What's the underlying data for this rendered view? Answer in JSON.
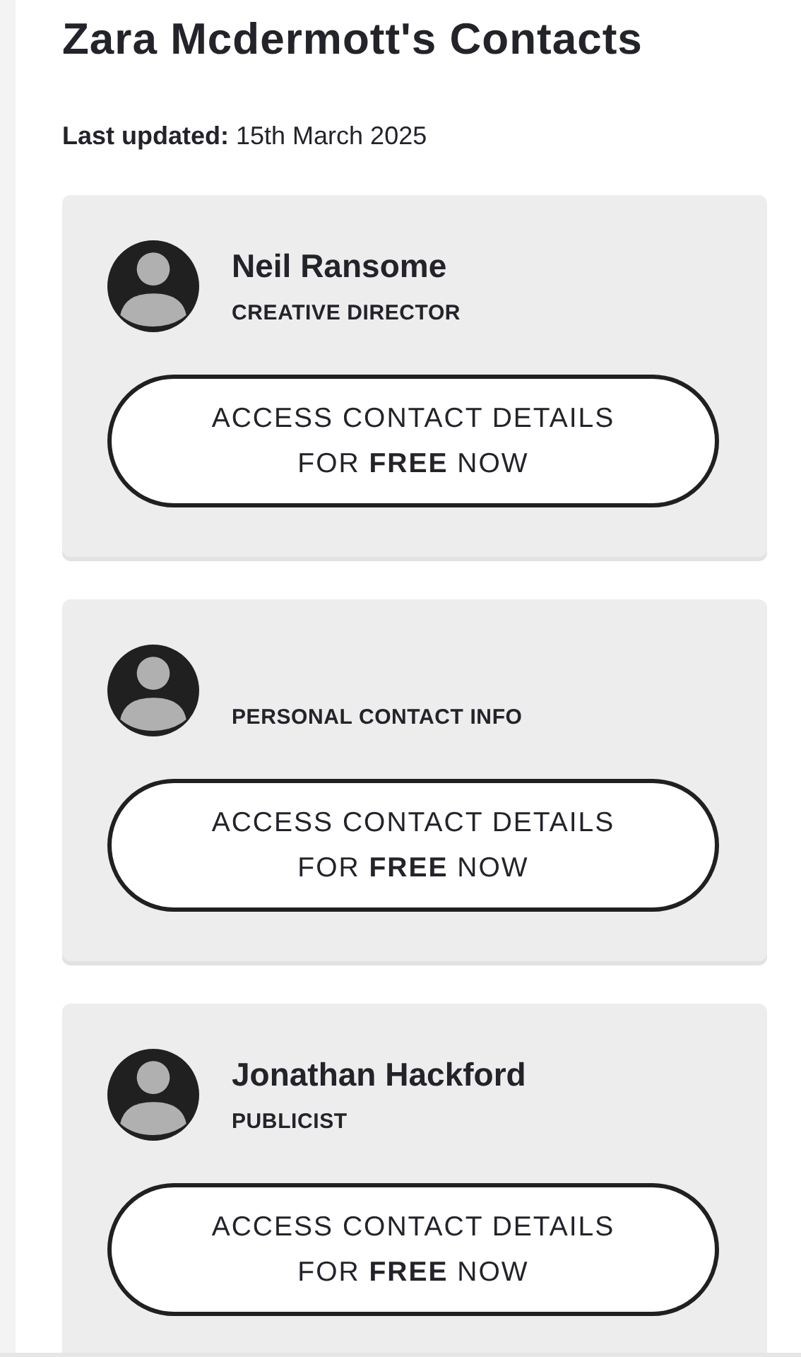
{
  "page": {
    "title": "Zara Mcdermott's Contacts",
    "last_updated_label": "Last updated:",
    "last_updated": "15th March 2025"
  },
  "contacts": [
    {
      "name": "Neil Ransome",
      "role": "CREATIVE DIRECTOR",
      "button": "ACCESS CONTACT DETAILS FOR **FREE** NOW"
    },
    {
      "role": "PERSONAL CONTACT INFO",
      "button": "ACCESS CONTACT DETAILS FOR **FREE** NOW"
    },
    {
      "name": "Jonathan Hackford",
      "role": "PUBLICIST",
      "button": "ACCESS CONTACT DETAILS FOR **FREE** NOW"
    }
  ]
}
